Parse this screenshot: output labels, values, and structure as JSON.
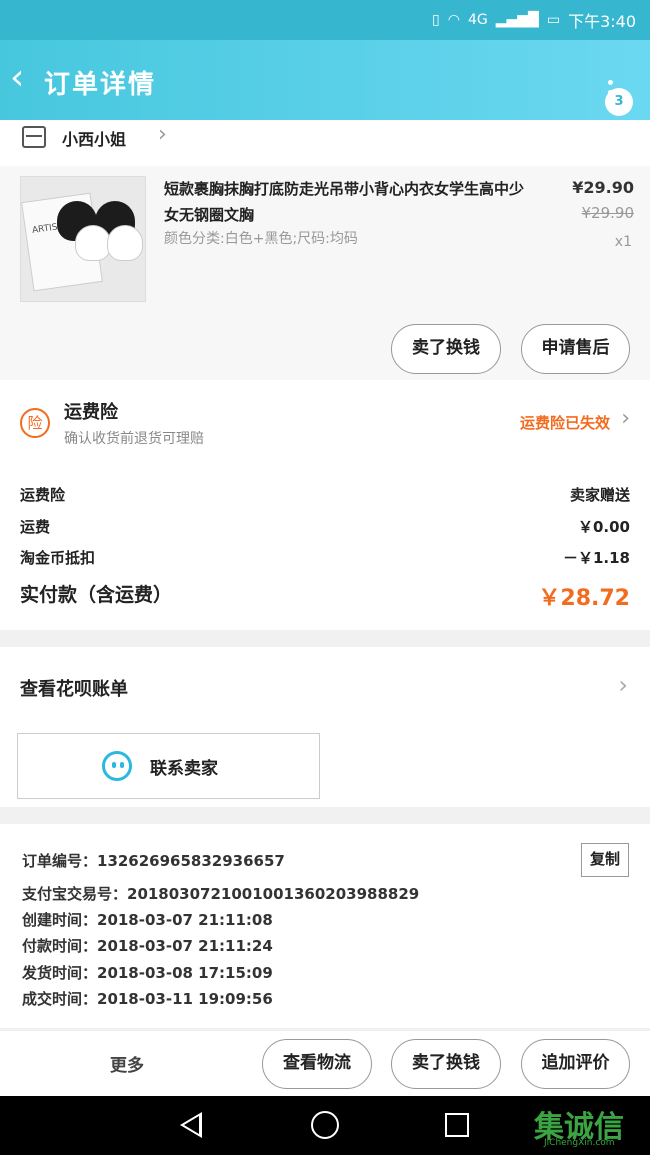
{
  "status_bar": {
    "network": "4G",
    "time": "下午3:40"
  },
  "header": {
    "title": "订单详情",
    "back_icon": "back-arrow-icon",
    "badge_count": "3"
  },
  "shop": {
    "name": "小西小姐"
  },
  "item": {
    "title": "短款裹胸抹胸打底防走光吊带小背心内衣女学生高中少女无钢圈文胸",
    "sku": "颜色分类:白色+黑色;尺码:均码",
    "price": "¥29.90",
    "original_price": "¥29.90",
    "quantity": "x1",
    "thumb_text": "ARTIST",
    "buttons": {
      "refund": "卖了换钱",
      "after_sale": "申请售后"
    }
  },
  "insurance": {
    "icon_text": "险",
    "title": "运费险",
    "subtitle": "确认收货前退货可理赔",
    "status": "运费险已失效"
  },
  "fees": [
    {
      "label": "运费险",
      "value": "卖家赠送"
    },
    {
      "label": "运费",
      "value": "￥0.00"
    },
    {
      "label": "淘金币抵扣",
      "value": "－￥1.18"
    }
  ],
  "total": {
    "label": "实付款（含运费）",
    "value": "￥28.72"
  },
  "huabei": {
    "label": "查看花呗账单"
  },
  "contact": {
    "label": "联系卖家"
  },
  "order_info": {
    "order_no": "订单编号：132626965832936657",
    "alipay_no": "支付宝交易号：2018030721001001360203988829",
    "created": "创建时间：2018-03-07 21:11:08",
    "paid": "付款时间：2018-03-07 21:11:24",
    "shipped": "发货时间：2018-03-08 17:15:09",
    "completed": "成交时间：2018-03-11 19:09:56",
    "copy_label": "复制"
  },
  "bottom_bar": {
    "more": "更多",
    "logistics": "查看物流",
    "resell": "卖了换钱",
    "append_review": "追加评价"
  },
  "watermark": {
    "text": "集诚信",
    "sub": "JiChengXin.com"
  },
  "colors": {
    "header": "#47c7de",
    "accent": "#f36b1f"
  }
}
